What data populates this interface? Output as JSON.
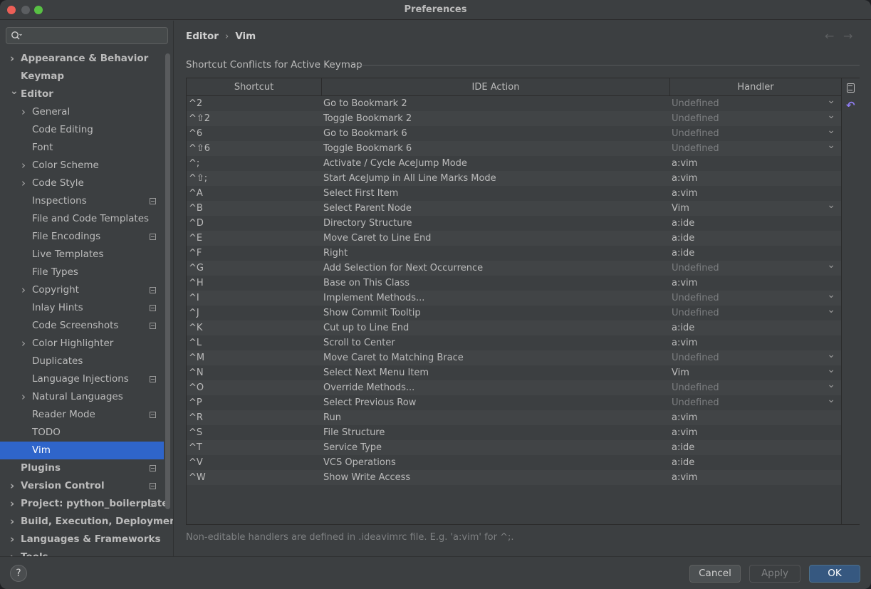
{
  "window": {
    "title": "Preferences"
  },
  "sidebar": {
    "search": {
      "placeholder": "",
      "value": ""
    },
    "items": [
      {
        "label": "Appearance & Behavior",
        "level": 0,
        "bold": true,
        "chevron": "right",
        "icon": false
      },
      {
        "label": "Keymap",
        "level": 0,
        "bold": true,
        "chevron": "none",
        "icon": false
      },
      {
        "label": "Editor",
        "level": 0,
        "bold": true,
        "chevron": "down",
        "icon": false
      },
      {
        "label": "General",
        "level": 1,
        "bold": false,
        "chevron": "right",
        "icon": false
      },
      {
        "label": "Code Editing",
        "level": 1,
        "bold": false,
        "chevron": "none",
        "icon": false
      },
      {
        "label": "Font",
        "level": 1,
        "bold": false,
        "chevron": "none",
        "icon": false
      },
      {
        "label": "Color Scheme",
        "level": 1,
        "bold": false,
        "chevron": "right",
        "icon": false
      },
      {
        "label": "Code Style",
        "level": 1,
        "bold": false,
        "chevron": "right",
        "icon": false
      },
      {
        "label": "Inspections",
        "level": 1,
        "bold": false,
        "chevron": "none",
        "icon": true
      },
      {
        "label": "File and Code Templates",
        "level": 1,
        "bold": false,
        "chevron": "none",
        "icon": false
      },
      {
        "label": "File Encodings",
        "level": 1,
        "bold": false,
        "chevron": "none",
        "icon": true
      },
      {
        "label": "Live Templates",
        "level": 1,
        "bold": false,
        "chevron": "none",
        "icon": false
      },
      {
        "label": "File Types",
        "level": 1,
        "bold": false,
        "chevron": "none",
        "icon": false
      },
      {
        "label": "Copyright",
        "level": 1,
        "bold": false,
        "chevron": "right",
        "icon": true
      },
      {
        "label": "Inlay Hints",
        "level": 1,
        "bold": false,
        "chevron": "none",
        "icon": true
      },
      {
        "label": "Code Screenshots",
        "level": 1,
        "bold": false,
        "chevron": "none",
        "icon": true
      },
      {
        "label": "Color Highlighter",
        "level": 1,
        "bold": false,
        "chevron": "right",
        "icon": false
      },
      {
        "label": "Duplicates",
        "level": 1,
        "bold": false,
        "chevron": "none",
        "icon": false
      },
      {
        "label": "Language Injections",
        "level": 1,
        "bold": false,
        "chevron": "none",
        "icon": true
      },
      {
        "label": "Natural Languages",
        "level": 1,
        "bold": false,
        "chevron": "right",
        "icon": false
      },
      {
        "label": "Reader Mode",
        "level": 1,
        "bold": false,
        "chevron": "none",
        "icon": true
      },
      {
        "label": "TODO",
        "level": 1,
        "bold": false,
        "chevron": "none",
        "icon": false
      },
      {
        "label": "Vim",
        "level": 1,
        "bold": false,
        "chevron": "none",
        "icon": false,
        "selected": true
      },
      {
        "label": "Plugins",
        "level": 0,
        "bold": true,
        "chevron": "none",
        "icon": true
      },
      {
        "label": "Version Control",
        "level": 0,
        "bold": true,
        "chevron": "right",
        "icon": true
      },
      {
        "label": "Project: python_boilerplate",
        "level": 0,
        "bold": true,
        "chevron": "right",
        "icon": true
      },
      {
        "label": "Build, Execution, Deployment",
        "level": 0,
        "bold": true,
        "chevron": "right",
        "icon": false
      },
      {
        "label": "Languages & Frameworks",
        "level": 0,
        "bold": true,
        "chevron": "right",
        "icon": false
      },
      {
        "label": "Tools",
        "level": 0,
        "bold": true,
        "chevron": "right",
        "icon": false
      }
    ]
  },
  "main": {
    "breadcrumb": {
      "parent": "Editor",
      "separator": "›",
      "current": "Vim"
    },
    "nav": {
      "back": "←",
      "forward": "→"
    },
    "section_title": "Shortcut Conflicts for Active Keymap",
    "table": {
      "columns": {
        "shortcut": "Shortcut",
        "action": "IDE Action",
        "handler": "Handler"
      },
      "rows": [
        {
          "shortcut": "^2",
          "action": "Go to Bookmark 2",
          "handler": "Undefined",
          "dropdown": true
        },
        {
          "shortcut": "^⇧2",
          "action": "Toggle Bookmark 2",
          "handler": "Undefined",
          "dropdown": true
        },
        {
          "shortcut": "^6",
          "action": "Go to Bookmark 6",
          "handler": "Undefined",
          "dropdown": true
        },
        {
          "shortcut": "^⇧6",
          "action": "Toggle Bookmark 6",
          "handler": "Undefined",
          "dropdown": true
        },
        {
          "shortcut": "^;",
          "action": "Activate / Cycle AceJump Mode",
          "handler": "a:vim",
          "dropdown": false
        },
        {
          "shortcut": "^⇧;",
          "action": "Start AceJump in All Line Marks Mode",
          "handler": "a:vim",
          "dropdown": false
        },
        {
          "shortcut": "^A",
          "action": "Select First Item",
          "handler": "a:vim",
          "dropdown": false
        },
        {
          "shortcut": "^B",
          "action": "Select Parent Node",
          "handler": "Vim",
          "dropdown": true
        },
        {
          "shortcut": "^D",
          "action": "Directory Structure",
          "handler": "a:ide",
          "dropdown": false
        },
        {
          "shortcut": "^E",
          "action": "Move Caret to Line End",
          "handler": "a:ide",
          "dropdown": false
        },
        {
          "shortcut": "^F",
          "action": "Right",
          "handler": "a:ide",
          "dropdown": false
        },
        {
          "shortcut": "^G",
          "action": "Add Selection for Next Occurrence",
          "handler": "Undefined",
          "dropdown": true
        },
        {
          "shortcut": "^H",
          "action": "Base on This Class",
          "handler": "a:vim",
          "dropdown": false
        },
        {
          "shortcut": "^I",
          "action": "Implement Methods...",
          "handler": "Undefined",
          "dropdown": true
        },
        {
          "shortcut": "^J",
          "action": "Show Commit Tooltip",
          "handler": "Undefined",
          "dropdown": true
        },
        {
          "shortcut": "^K",
          "action": "Cut up to Line End",
          "handler": "a:ide",
          "dropdown": false
        },
        {
          "shortcut": "^L",
          "action": "Scroll to Center",
          "handler": "a:vim",
          "dropdown": false
        },
        {
          "shortcut": "^M",
          "action": "Move Caret to Matching Brace",
          "handler": "Undefined",
          "dropdown": true
        },
        {
          "shortcut": "^N",
          "action": "Select Next Menu Item",
          "handler": "Vim",
          "dropdown": true
        },
        {
          "shortcut": "^O",
          "action": "Override Methods...",
          "handler": "Undefined",
          "dropdown": true
        },
        {
          "shortcut": "^P",
          "action": "Select Previous Row",
          "handler": "Undefined",
          "dropdown": true
        },
        {
          "shortcut": "^R",
          "action": "Run",
          "handler": "a:vim",
          "dropdown": false
        },
        {
          "shortcut": "^S",
          "action": "File Structure",
          "handler": "a:vim",
          "dropdown": false
        },
        {
          "shortcut": "^T",
          "action": "Service Type",
          "handler": "a:ide",
          "dropdown": false
        },
        {
          "shortcut": "^V",
          "action": "VCS Operations",
          "handler": "a:ide",
          "dropdown": false
        },
        {
          "shortcut": "^W",
          "action": "Show Write Access",
          "handler": "a:vim",
          "dropdown": false
        }
      ]
    },
    "footnote": "Non-editable handlers are defined in .ideavimrc file. E.g. 'a:vim' for ^;."
  },
  "bottom": {
    "help_label": "?",
    "cancel_label": "Cancel",
    "apply_label": "Apply",
    "ok_label": "OK"
  },
  "colors": {
    "selection": "#2f65ca",
    "ok_button": "#365880",
    "undo_icon": "#8f7df2",
    "close": "#ec5f57",
    "maximize": "#58c044"
  },
  "icons": {
    "search": "search-icon",
    "copy": "copy-icon",
    "undo": "undo-icon",
    "project_settings": "project-settings-icon"
  }
}
